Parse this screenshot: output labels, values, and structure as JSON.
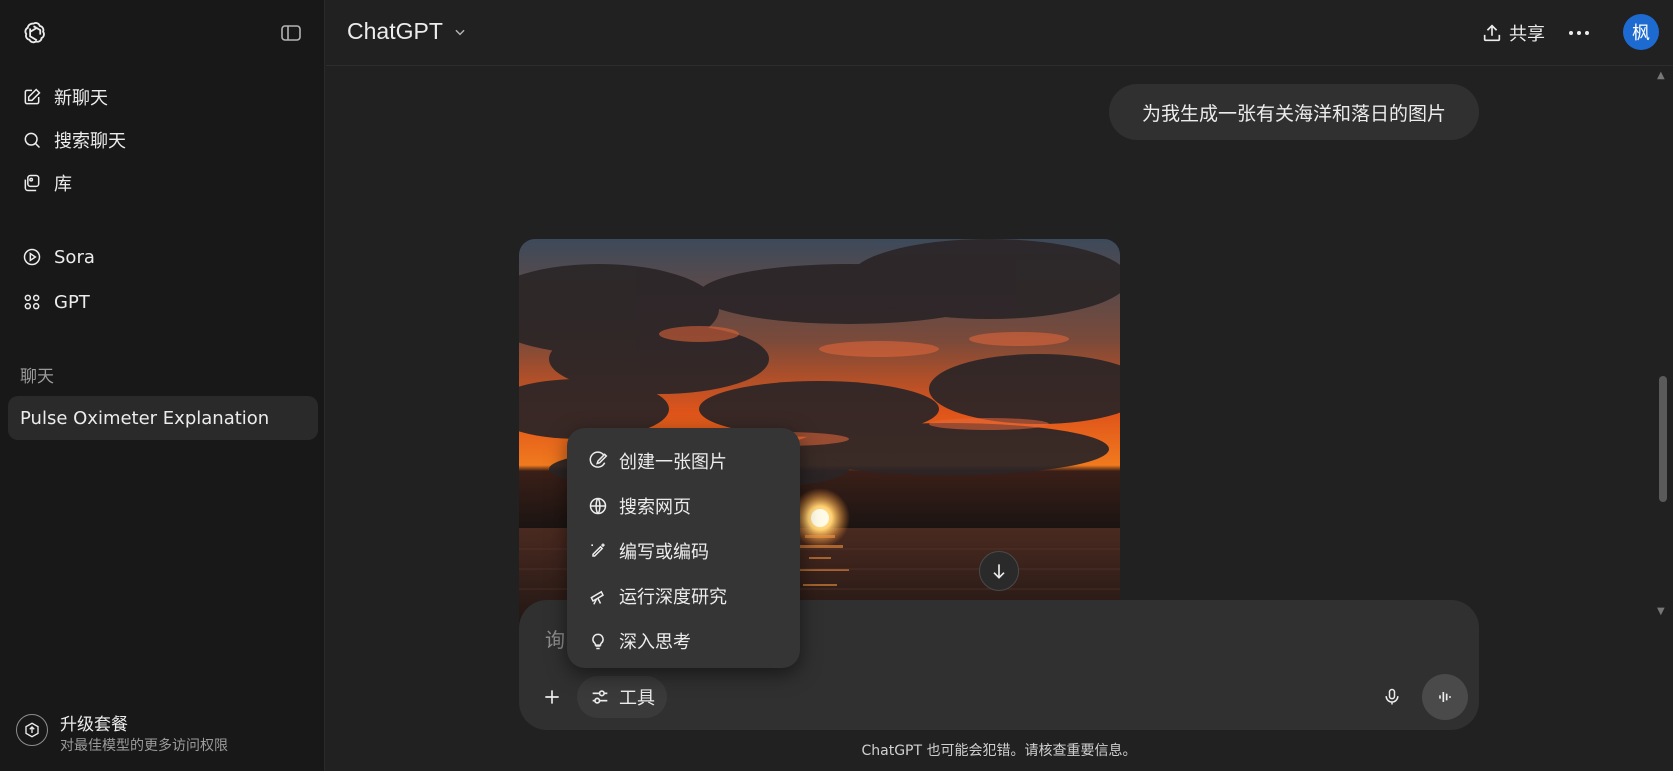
{
  "sidebar": {
    "items": [
      {
        "label": "新聊天",
        "icon": "new-chat-icon"
      },
      {
        "label": "搜索聊天",
        "icon": "search-icon"
      },
      {
        "label": "库",
        "icon": "library-icon"
      },
      {
        "label": "Sora",
        "icon": "play-circle-icon"
      },
      {
        "label": "GPT",
        "icon": "grid-icon"
      }
    ],
    "section_label": "聊天",
    "chats": [
      "Pulse Oximeter Explanation"
    ],
    "upgrade": {
      "title": "升级套餐",
      "subtitle": "对最佳模型的更多访问权限"
    }
  },
  "header": {
    "model": "ChatGPT",
    "share_label": "共享",
    "avatar_initial": "枫"
  },
  "conversation": {
    "user_message": "为我生成一张有关海洋和落日的图片"
  },
  "composer": {
    "placeholder": "询",
    "tools_label": "工具"
  },
  "tools_menu": [
    {
      "label": "创建一张图片",
      "icon": "image-create-icon"
    },
    {
      "label": "搜索网页",
      "icon": "globe-icon"
    },
    {
      "label": "编写或编码",
      "icon": "pen-sparkle-icon"
    },
    {
      "label": "运行深度研究",
      "icon": "telescope-icon"
    },
    {
      "label": "深入思考",
      "icon": "lightbulb-icon"
    }
  ],
  "disclaimer": "ChatGPT 也可能会犯错。请核查重要信息。",
  "colors": {
    "accent_avatar": "#1d6bd1",
    "background": "#212121",
    "sidebar": "#181818"
  }
}
